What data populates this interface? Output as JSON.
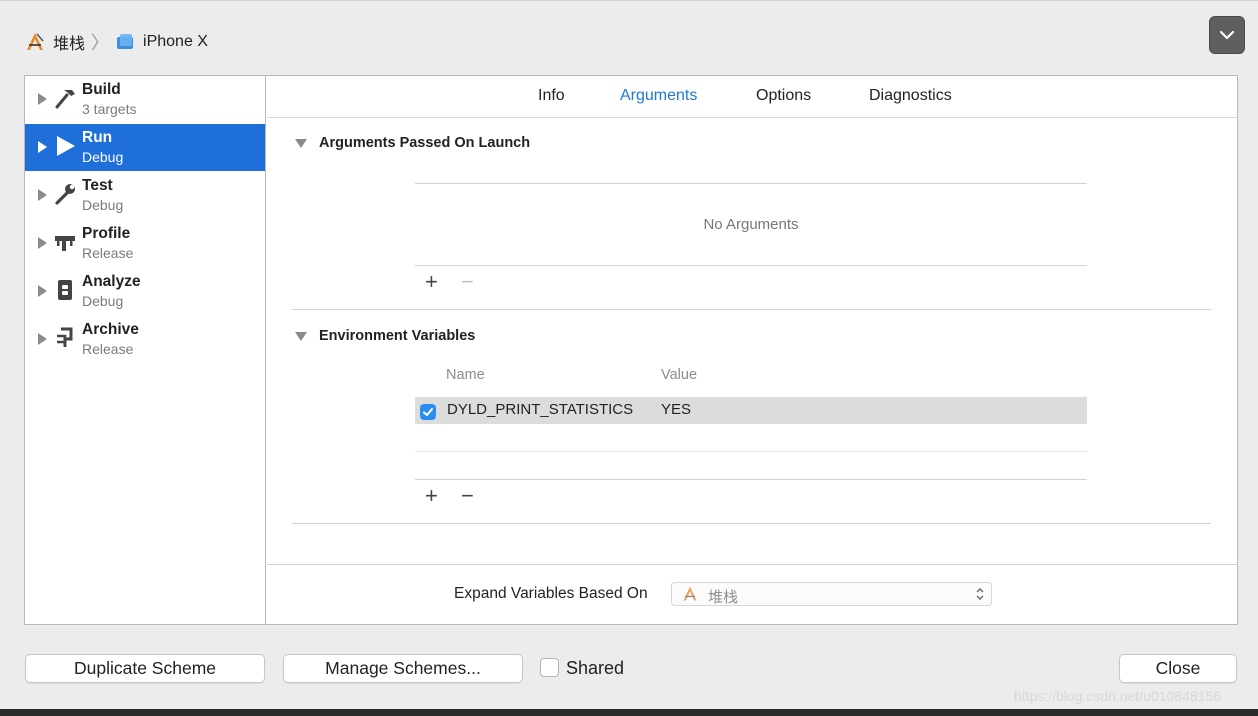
{
  "breadcrumb": {
    "project": "堆栈",
    "device": "iPhone X"
  },
  "sidebar": {
    "items": [
      {
        "title": "Build",
        "subtitle": "3 targets"
      },
      {
        "title": "Run",
        "subtitle": "Debug"
      },
      {
        "title": "Test",
        "subtitle": "Debug"
      },
      {
        "title": "Profile",
        "subtitle": "Release"
      },
      {
        "title": "Analyze",
        "subtitle": "Debug"
      },
      {
        "title": "Archive",
        "subtitle": "Release"
      }
    ]
  },
  "tabs": [
    {
      "label": "Info"
    },
    {
      "label": "Arguments"
    },
    {
      "label": "Options"
    },
    {
      "label": "Diagnostics"
    }
  ],
  "arguments_section": {
    "title": "Arguments Passed On Launch",
    "empty_text": "No Arguments",
    "add": "+",
    "remove": "−"
  },
  "env_section": {
    "title": "Environment Variables",
    "col_name": "Name",
    "col_value": "Value",
    "rows": [
      {
        "name": "DYLD_PRINT_STATISTICS",
        "value": "YES",
        "enabled": true
      }
    ],
    "add": "+",
    "remove": "−"
  },
  "expand": {
    "label": "Expand Variables Based On",
    "value": "堆栈"
  },
  "buttons": {
    "duplicate": "Duplicate Scheme",
    "manage": "Manage Schemes...",
    "shared": "Shared",
    "close": "Close"
  },
  "watermark": "https://blog.csdn.net/u010848156",
  "colors": {
    "accent": "#1e6fd9",
    "active_tab": "#1f77d6"
  }
}
